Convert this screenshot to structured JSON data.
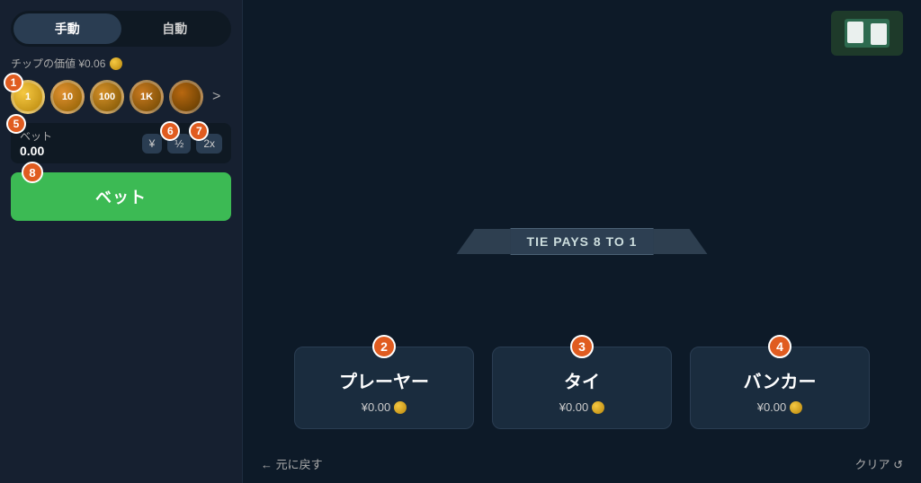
{
  "leftPanel": {
    "modeManual": "手動",
    "modeAuto": "自動",
    "chipValueLabel": "チップの価値 ¥0.06",
    "chips": [
      {
        "label": "1",
        "class": "chip-1"
      },
      {
        "label": "10",
        "class": "chip-10"
      },
      {
        "label": "100",
        "class": "chip-100"
      },
      {
        "label": "1K",
        "class": "chip-1k"
      },
      {
        "label": "",
        "class": "chip-extra"
      }
    ],
    "moreLabel": ">",
    "betLabel": "ベット",
    "betAmount": "0.00",
    "halfLabel": "½",
    "doubleLabel": "2x",
    "placeBetLabel": "ベット",
    "badgeNumbers": [
      "1",
      "5",
      "6",
      "7",
      "8"
    ]
  },
  "mainArea": {
    "tiePaysBanner": "TIE PAYS 8 TO 1",
    "betZones": [
      {
        "id": "player",
        "title": "プレーヤー",
        "amount": "¥0.00",
        "badgeNum": "2"
      },
      {
        "id": "tie",
        "title": "タイ",
        "amount": "¥0.00",
        "badgeNum": "3"
      },
      {
        "id": "banker",
        "title": "バンカー",
        "amount": "¥0.00",
        "badgeNum": "4"
      }
    ],
    "backLabel": "← 元に戻す",
    "clearLabel": "クリア ↺"
  },
  "colors": {
    "accent": "#3cba54",
    "badge": "#e05c20",
    "panelBg": "#162030",
    "mainBg": "#0d1a28"
  }
}
